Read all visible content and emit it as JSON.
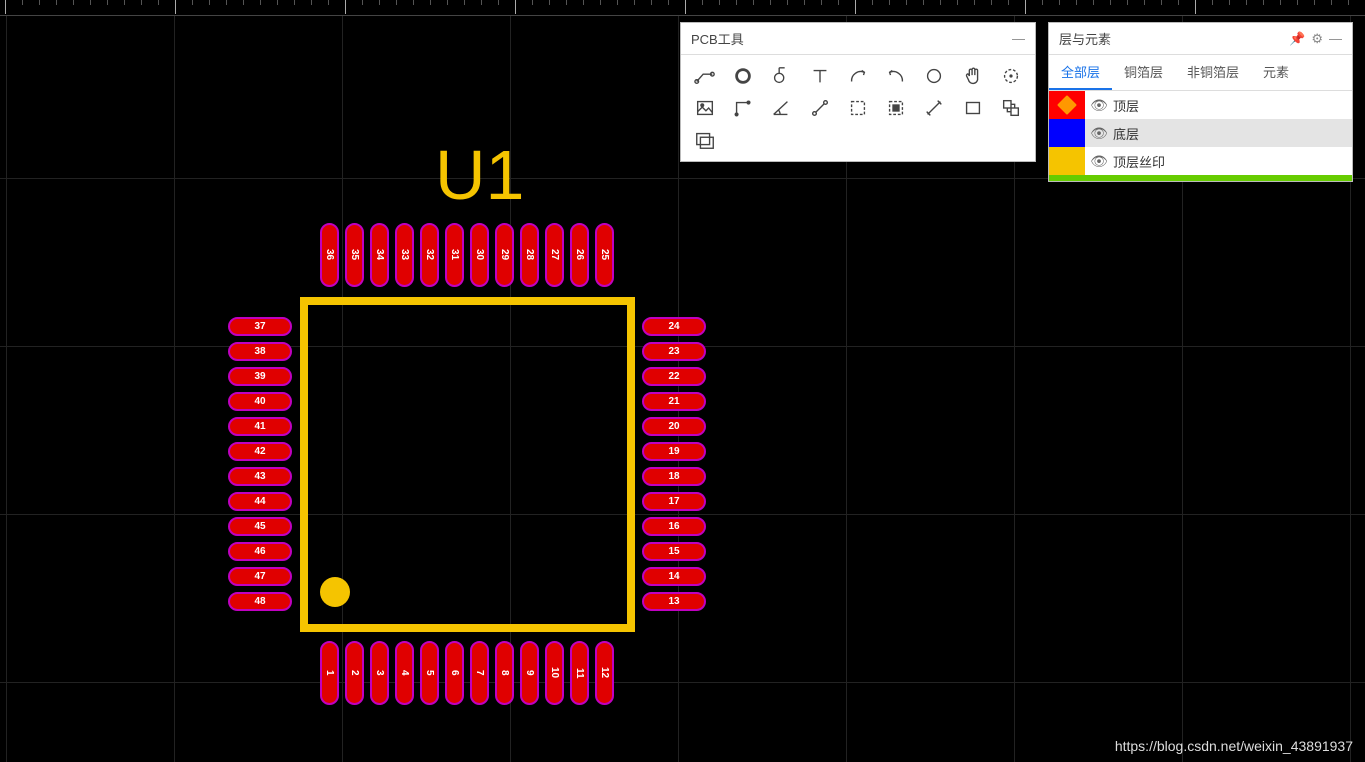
{
  "tools_panel": {
    "title": "PCB工具"
  },
  "layers_panel": {
    "title": "层与元素",
    "tabs": [
      "全部层",
      "铜箔层",
      "非铜箔层",
      "元素"
    ],
    "active_tab": 0,
    "layers": [
      {
        "color": "#ff0000",
        "name": "顶层",
        "editing": true,
        "visible": true,
        "selected": false
      },
      {
        "color": "#0000ff",
        "name": "底层",
        "editing": false,
        "visible": true,
        "selected": true
      },
      {
        "color": "#f5c400",
        "name": "顶层丝印",
        "editing": false,
        "visible": true,
        "selected": false
      }
    ]
  },
  "component": {
    "designator": "U1",
    "pads_bottom": [
      "1",
      "2",
      "3",
      "4",
      "5",
      "6",
      "7",
      "8",
      "9",
      "10",
      "11",
      "12"
    ],
    "pads_right": [
      "13",
      "14",
      "15",
      "16",
      "17",
      "18",
      "19",
      "20",
      "21",
      "22",
      "23",
      "24"
    ],
    "pads_top": [
      "25",
      "26",
      "27",
      "28",
      "29",
      "30",
      "31",
      "32",
      "33",
      "34",
      "35",
      "36"
    ],
    "pads_left": [
      "37",
      "38",
      "39",
      "40",
      "41",
      "42",
      "43",
      "44",
      "45",
      "46",
      "47",
      "48"
    ]
  },
  "watermark": "https://blog.csdn.net/weixin_43891937"
}
